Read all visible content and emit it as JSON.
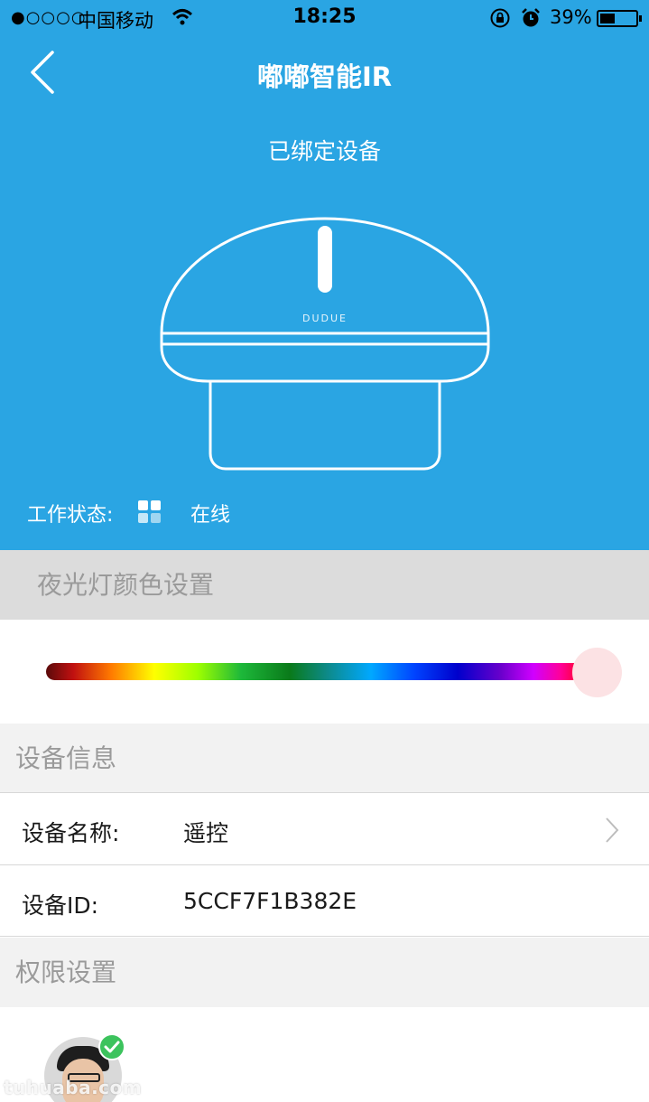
{
  "status_bar": {
    "signal": "●○○○○",
    "carrier": "中国移动",
    "time": "18:25",
    "battery_percent": "39%",
    "battery_level": 0.39
  },
  "nav": {
    "title": "嘟嘟智能IR",
    "back_icon": "chevron-left-icon"
  },
  "hero": {
    "subtitle": "已绑定设备",
    "brand_mark": "DUDUE",
    "work_status_label": "工作状态:",
    "work_status_value": "在线",
    "background_color": "#2aa5e3"
  },
  "night_light": {
    "header": "夜光灯颜色设置",
    "slider_value": 1.0
  },
  "device_info": {
    "header": "设备信息",
    "name_label": "设备名称:",
    "name_value": "遥控",
    "id_label": "设备ID:",
    "id_value": "5CCF7F1B382E"
  },
  "permissions": {
    "header": "权限设置"
  },
  "watermark": "tuhuaba.com"
}
